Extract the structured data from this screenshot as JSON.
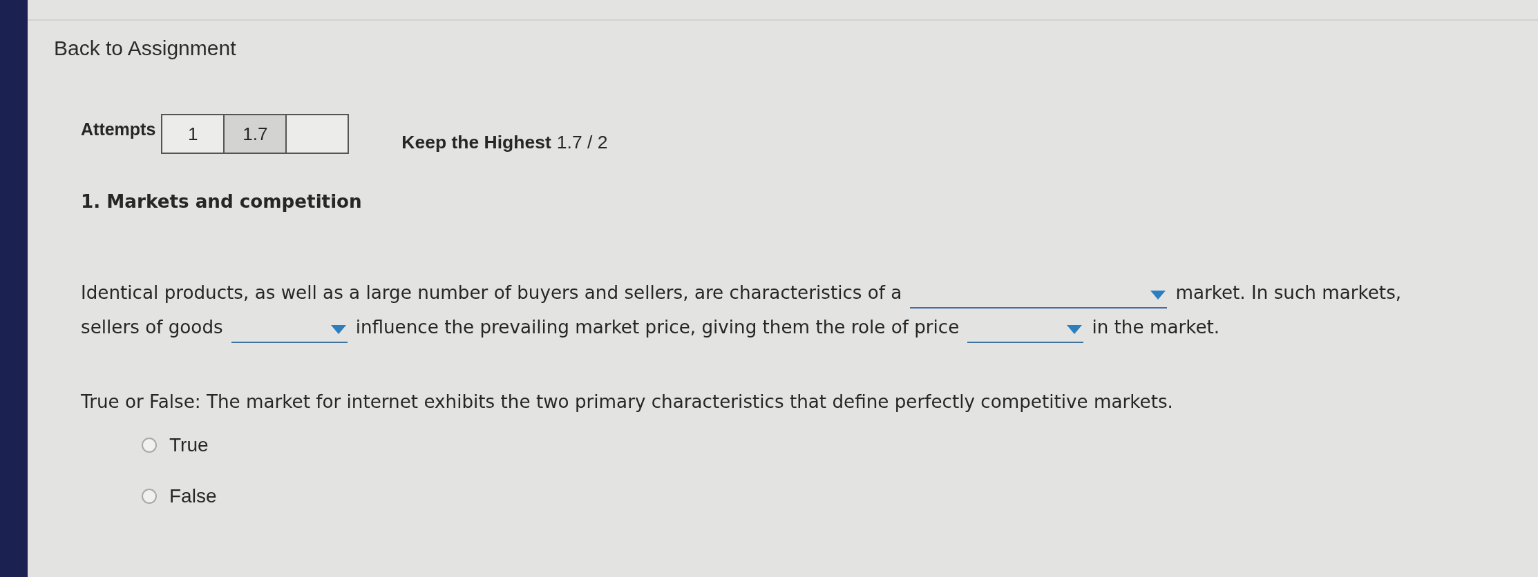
{
  "back_link": "Back to Assignment",
  "attempts": {
    "label": "Attempts",
    "cells": [
      {
        "value": "1",
        "selected": false
      },
      {
        "value": "1.7",
        "selected": true
      },
      {
        "selected": false
      }
    ],
    "policy": "Keep the Highest",
    "score": "1.7 / 2"
  },
  "question": {
    "title": "1. Markets and competition",
    "paragraph": {
      "lines": [
        [
          {
            "kind": "text",
            "text": "Identical products, as well as a large number of buyers and sellers, are characteristics of a"
          },
          {
            "kind": "dropdown"
          },
          {
            "kind": "text",
            "text": "market. In such markets,"
          }
        ],
        [
          {
            "kind": "text",
            "text": "sellers of goods"
          },
          {
            "kind": "dropdown"
          },
          {
            "kind": "text",
            "text": "influence the prevailing market price, giving them the role of price"
          },
          {
            "kind": "dropdown"
          },
          {
            "kind": "text",
            "text": "in the market."
          }
        ]
      ]
    },
    "true_false": {
      "prompt": "True or False: The market for internet exhibits the two primary characteristics that define perfectly competitive markets.",
      "options": [
        {
          "label": "True",
          "selected": false
        },
        {
          "label": "False",
          "selected": false
        }
      ]
    }
  }
}
